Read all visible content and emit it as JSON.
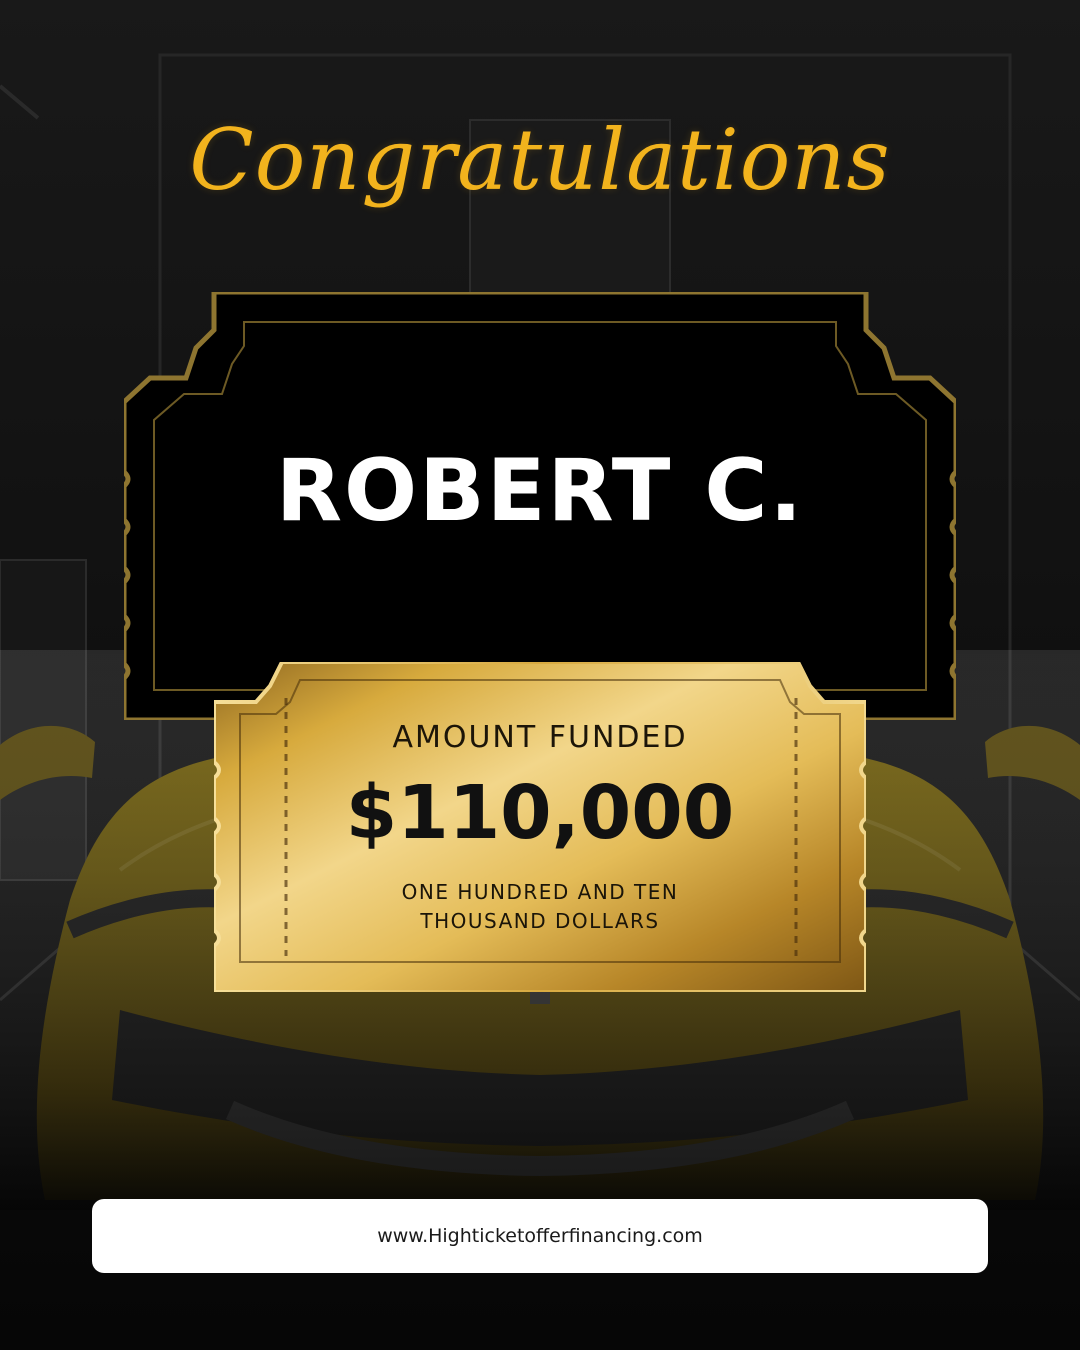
{
  "headline": {
    "text": "Congratulations"
  },
  "name_ticket": {
    "name": "ROBERT C."
  },
  "funding_ticket": {
    "label": "AMOUNT FUNDED",
    "amount": "$110,000",
    "amount_words_line1": "ONE HUNDRED AND TEN",
    "amount_words_line2": "THOUSAND DOLLARS"
  },
  "footer": {
    "website": "www.Highticketofferfinancing.com"
  },
  "colors": {
    "gold_script": "#f2b31d",
    "black_ticket": "#000000",
    "gold_ticket": "#d8b24b",
    "footer_bg": "#ffffff"
  }
}
